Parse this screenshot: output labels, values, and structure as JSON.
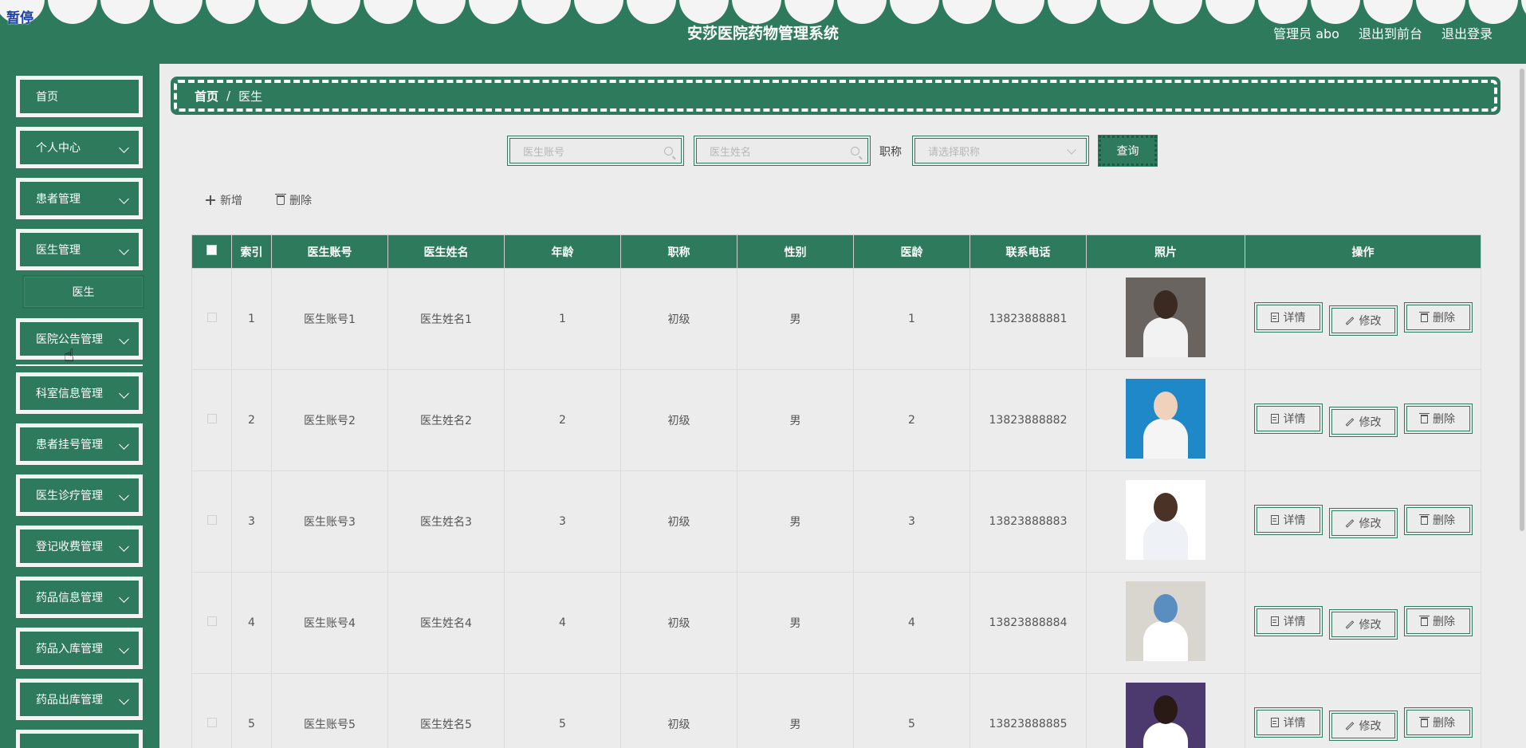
{
  "header": {
    "pause_label": "暂停",
    "title": "安莎医院药物管理系统",
    "user": "管理员 abo",
    "to_frontend": "退出到前台",
    "logout": "退出登录"
  },
  "sidebar": {
    "items": [
      {
        "label": "首页",
        "has_children": false
      },
      {
        "label": "个人中心",
        "has_children": true
      },
      {
        "label": "患者管理",
        "has_children": true
      },
      {
        "label": "医生管理",
        "has_children": true
      },
      {
        "label": "医院公告管理",
        "has_children": true
      },
      {
        "label": "科室信息管理",
        "has_children": true
      },
      {
        "label": "患者挂号管理",
        "has_children": true
      },
      {
        "label": "医生诊疗管理",
        "has_children": true
      },
      {
        "label": "登记收费管理",
        "has_children": true
      },
      {
        "label": "药品信息管理",
        "has_children": true
      },
      {
        "label": "药品入库管理",
        "has_children": true
      },
      {
        "label": "药品出库管理",
        "has_children": true
      }
    ],
    "submenu": {
      "label": "医生"
    }
  },
  "breadcrumb": {
    "home": "首页",
    "separator": "/",
    "current": "医生"
  },
  "search": {
    "account_placeholder": "医生账号",
    "name_placeholder": "医生姓名",
    "title_label": "职称",
    "title_placeholder": "请选择职称",
    "query_button": "查询"
  },
  "actions": {
    "add": "新增",
    "delete": "删除"
  },
  "table": {
    "headers": [
      "索引",
      "医生账号",
      "医生姓名",
      "年龄",
      "职称",
      "性别",
      "医龄",
      "联系电话",
      "照片",
      "操作"
    ],
    "rows": [
      {
        "index": "1",
        "account": "医生账号1",
        "name": "医生姓名1",
        "age": "1",
        "title": "初级",
        "gender": "男",
        "years": "1",
        "phone": "13823888881"
      },
      {
        "index": "2",
        "account": "医生账号2",
        "name": "医生姓名2",
        "age": "2",
        "title": "初级",
        "gender": "男",
        "years": "2",
        "phone": "13823888882"
      },
      {
        "index": "3",
        "account": "医生账号3",
        "name": "医生姓名3",
        "age": "3",
        "title": "初级",
        "gender": "男",
        "years": "3",
        "phone": "13823888883"
      },
      {
        "index": "4",
        "account": "医生账号4",
        "name": "医生姓名4",
        "age": "4",
        "title": "初级",
        "gender": "男",
        "years": "4",
        "phone": "13823888884"
      },
      {
        "index": "5",
        "account": "医生账号5",
        "name": "医生姓名5",
        "age": "5",
        "title": "初级",
        "gender": "男",
        "years": "5",
        "phone": "13823888885"
      }
    ],
    "op_detail": "详情",
    "op_edit": "修改",
    "op_delete": "删除"
  },
  "colors": {
    "primary": "#2e7a5d",
    "background": "#ececec",
    "scallop": "#f4f4f4"
  },
  "icons": [
    "search-icon",
    "chevron-down-icon",
    "plus-icon",
    "trash-icon",
    "document-icon",
    "pen-icon"
  ]
}
